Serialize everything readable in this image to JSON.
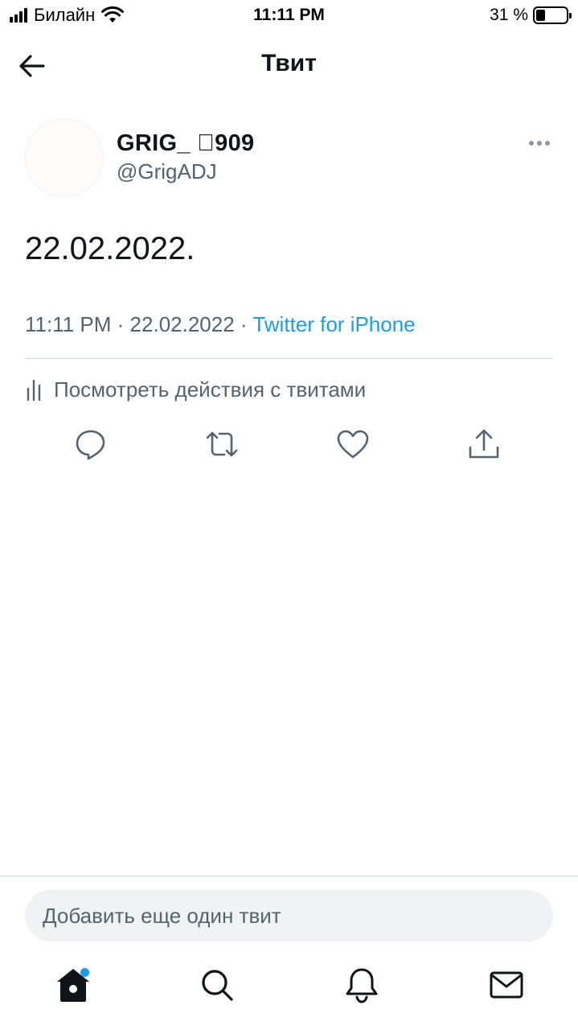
{
  "status_bar": {
    "carrier": "Билайн",
    "time": "11:11 PM",
    "battery_text": "31 %",
    "battery_level": 0.31
  },
  "header": {
    "title": "Твит"
  },
  "tweet": {
    "display_name": "GRIG_ 909",
    "handle": "@GrigADJ",
    "text": "22.02.2022.",
    "time": "11:11 PM",
    "separator": " · ",
    "date": "22.02.2022",
    "source": "Twitter for iPhone",
    "activity_label": "Посмотреть действия с твитами"
  },
  "reply": {
    "placeholder": "Добавить еще один твит"
  },
  "icons": {
    "back": "arrow-left-icon",
    "more": "more-horizontal-icon",
    "activity": "bar-chart-icon",
    "reply": "speech-bubble-icon",
    "retweet": "retweet-icon",
    "like": "heart-icon",
    "share": "share-icon",
    "home": "home-icon",
    "search": "search-icon",
    "notifications": "bell-icon",
    "messages": "envelope-icon"
  },
  "colors": {
    "accent": "#1d9bf0",
    "secondary_text": "#536471",
    "primary_text": "#0f1419"
  }
}
